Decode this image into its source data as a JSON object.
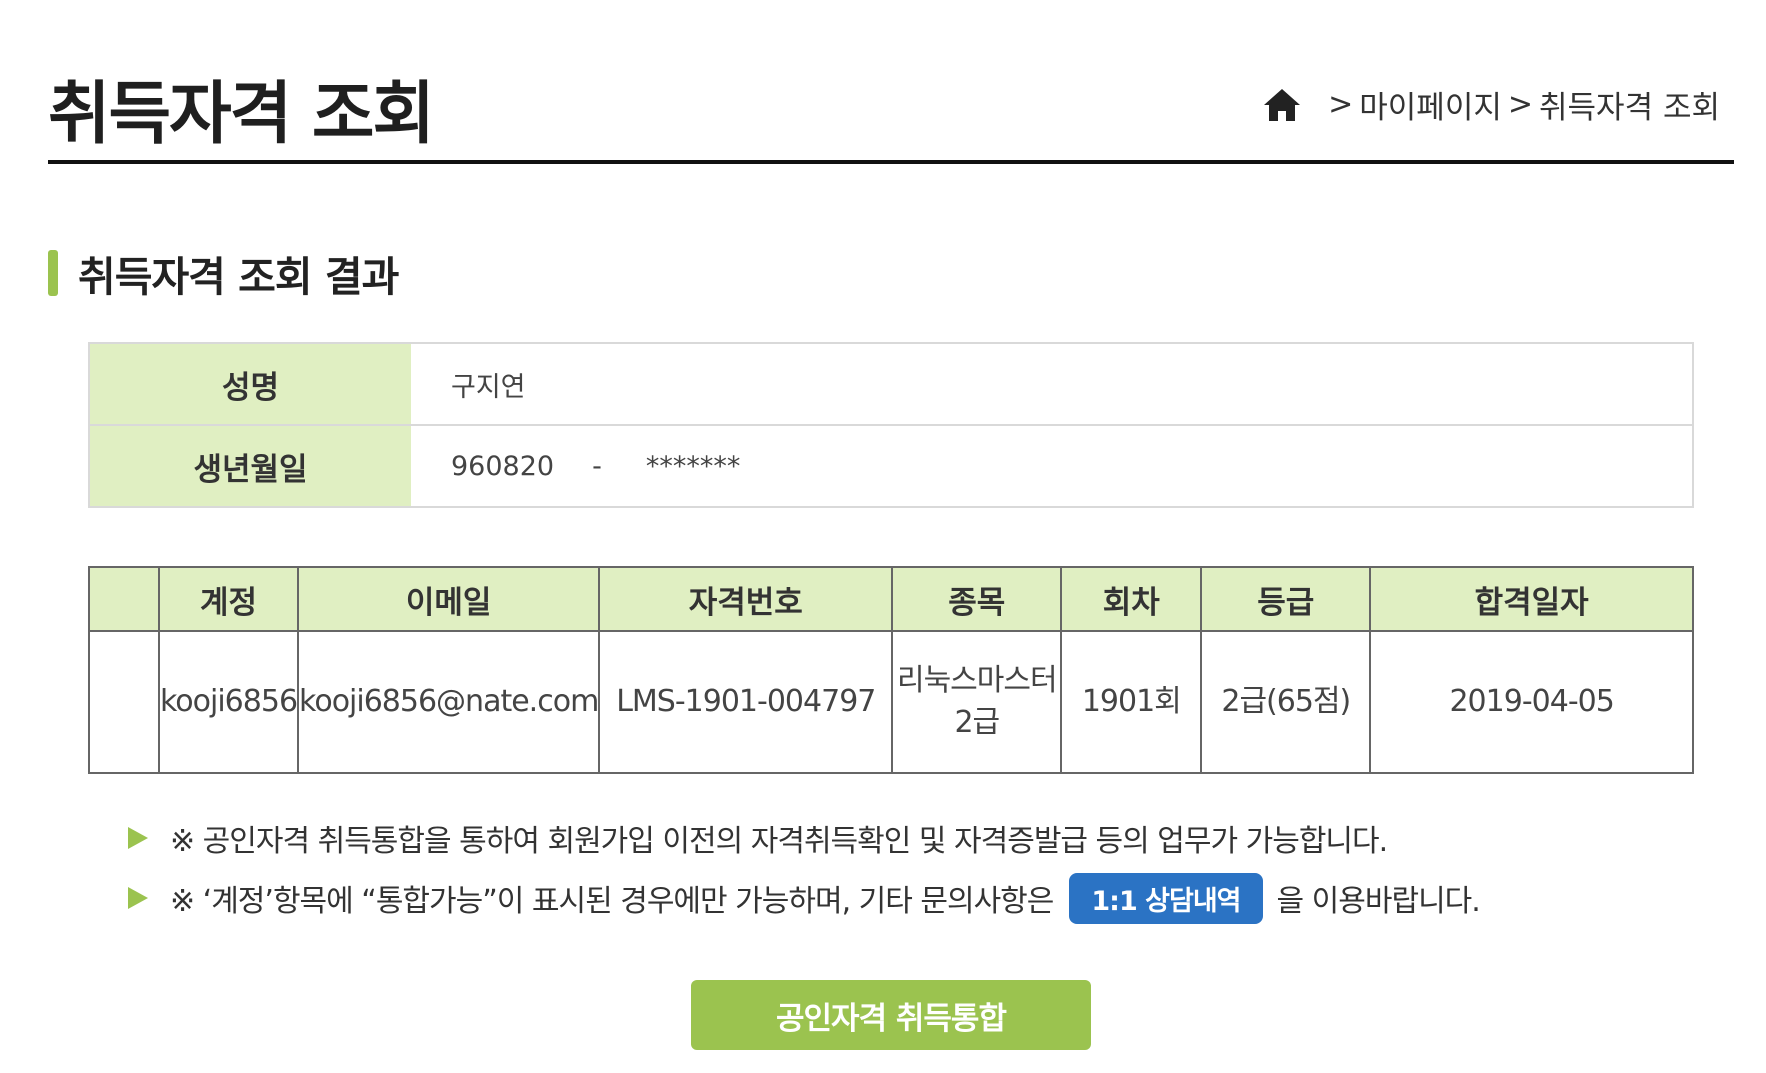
{
  "header": {
    "title": "취득자격 조회",
    "breadcrumb": [
      "마이페이지",
      "취득자격 조회"
    ]
  },
  "section": {
    "title": "취득자격 조회 결과"
  },
  "info": {
    "name_label": "성명",
    "name_value": "구지연",
    "birth_label": "생년월일",
    "birth_front": "960820",
    "birth_dash": "-",
    "birth_back": "*******"
  },
  "results": {
    "columns": [
      "",
      "계정",
      "이메일",
      "자격번호",
      "종목",
      "회차",
      "등급",
      "합격일자"
    ],
    "rows": [
      {
        "blank": "",
        "account": "kooji6856",
        "email": "kooji6856@nate.com",
        "cert_no": "LMS-1901-004797",
        "subject_line1": "리눅스마스터",
        "subject_line2": "2급",
        "round": "1901회",
        "grade": "2급(65점)",
        "pass_date": "2019-04-05"
      }
    ]
  },
  "notes": {
    "line1": "※ 공인자격 취득통합을 통하여 회원가입 이전의 자격취득확인 및 자격증발급 등의 업무가 가능합니다.",
    "line2_before": "※ ‘계정’항목에 “통합가능”이 표시된 경우에만 가능하며, 기타 문의사항은",
    "consult_button": "1:1 상담내역",
    "line2_after": "을 이용바랍니다."
  },
  "actions": {
    "integrate_button": "공인자격 취득통합"
  },
  "colors": {
    "accent_green": "#9bc34f",
    "header_cell_green": "#e0efc2",
    "consult_blue": "#2b73c4"
  },
  "icons": {
    "home": "home-icon",
    "bullet": "triangle-right-icon"
  }
}
